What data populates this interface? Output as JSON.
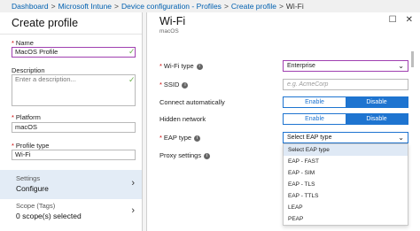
{
  "breadcrumb": {
    "items": [
      "Dashboard",
      "Microsoft Intune",
      "Device configuration - Profiles",
      "Create profile",
      "Wi-Fi"
    ],
    "separator": ">"
  },
  "left_blade": {
    "title": "Create profile",
    "name": {
      "label": "Name",
      "value": "MacOS Profile"
    },
    "description": {
      "label": "Description",
      "placeholder": "Enter a description..."
    },
    "platform": {
      "label": "Platform",
      "value": "macOS"
    },
    "profile_type": {
      "label": "Profile type",
      "value": "Wi-Fi"
    },
    "settings": {
      "label": "Settings",
      "value": "Configure"
    },
    "scope": {
      "label": "Scope (Tags)",
      "value": "0 scope(s) selected"
    }
  },
  "right_blade": {
    "title": "Wi-Fi",
    "subtitle": "macOS",
    "wifi_type": {
      "label": "Wi-Fi type",
      "value": "Enterprise"
    },
    "ssid": {
      "label": "SSID",
      "placeholder": "e.g. AcmeCorp"
    },
    "connect_automatically": {
      "label": "Connect automatically",
      "enable": "Enable",
      "disable": "Disable"
    },
    "hidden_network": {
      "label": "Hidden network",
      "enable": "Enable",
      "disable": "Disable"
    },
    "eap_type": {
      "label": "EAP type",
      "value": "Select EAP type",
      "options": [
        "Select EAP type",
        "EAP - FAST",
        "EAP - SIM",
        "EAP - TLS",
        "EAP - TTLS",
        "LEAP",
        "PEAP"
      ]
    },
    "proxy_settings": {
      "label": "Proxy settings"
    }
  },
  "icons": {
    "info": "info-icon",
    "chevron": "chevron-down-icon",
    "nav": "chevron-right-icon",
    "check": "check-icon"
  },
  "colors": {
    "accent": "#1e74d0",
    "focus_border": "#a040b0",
    "check": "#6ab04c",
    "required": "#c00000"
  }
}
